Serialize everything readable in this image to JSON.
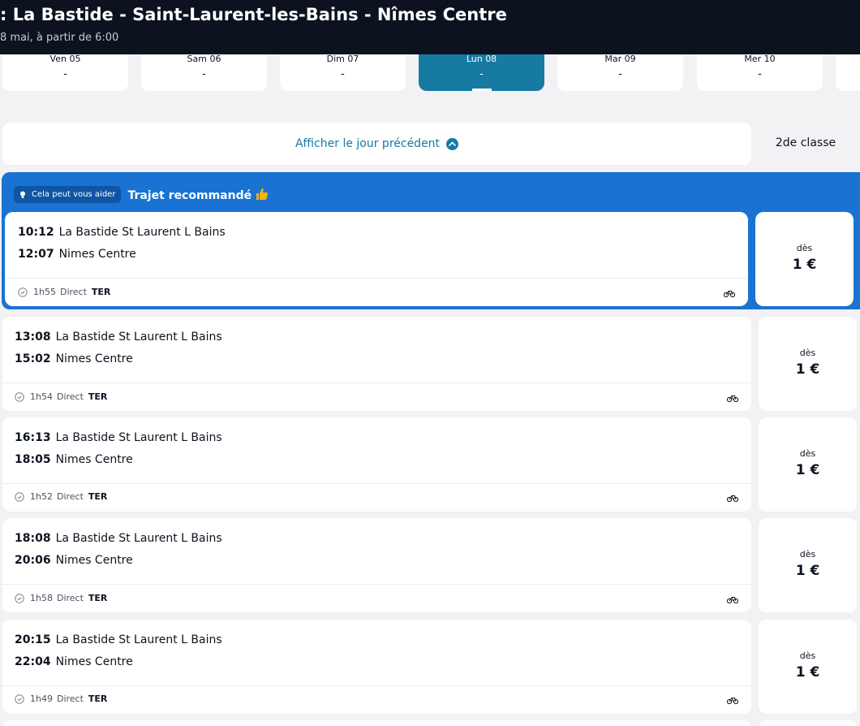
{
  "header": {
    "title": ": La Bastide - Saint-Laurent-les-Bains - Nîmes Centre",
    "subtitle": "8 mai, à partir de 6:00"
  },
  "days": [
    {
      "label": "Ven 05",
      "price": "-"
    },
    {
      "label": "Sam 06",
      "price": "-"
    },
    {
      "label": "Dim 07",
      "price": "-"
    },
    {
      "label": "Lun 08",
      "price": "-",
      "selected": true
    },
    {
      "label": "Mar 09",
      "price": "-"
    },
    {
      "label": "Mer 10",
      "price": "-"
    }
  ],
  "prev_day_label": "Afficher le jour précédent",
  "class_label": "2de classe",
  "recommendation": {
    "help_label": "Cela peut vous aider",
    "title": "Trajet recommandé"
  },
  "price_from_label": "dès",
  "trips": [
    {
      "dep_time": "10:12",
      "dep_station": "La Bastide St Laurent L Bains",
      "arr_time": "12:07",
      "arr_station": "Nimes Centre",
      "duration": "1h55",
      "type": "Direct",
      "train": "TER",
      "price": "1 €"
    },
    {
      "dep_time": "13:08",
      "dep_station": "La Bastide St Laurent L Bains",
      "arr_time": "15:02",
      "arr_station": "Nimes Centre",
      "duration": "1h54",
      "type": "Direct",
      "train": "TER",
      "price": "1 €"
    },
    {
      "dep_time": "16:13",
      "dep_station": "La Bastide St Laurent L Bains",
      "arr_time": "18:05",
      "arr_station": "Nimes Centre",
      "duration": "1h52",
      "type": "Direct",
      "train": "TER",
      "price": "1 €"
    },
    {
      "dep_time": "18:08",
      "dep_station": "La Bastide St Laurent L Bains",
      "arr_time": "20:06",
      "arr_station": "Nimes Centre",
      "duration": "1h58",
      "type": "Direct",
      "train": "TER",
      "price": "1 €"
    },
    {
      "dep_time": "20:15",
      "dep_station": "La Bastide St Laurent L Bains",
      "arr_time": "22:04",
      "arr_station": "Nimes Centre",
      "duration": "1h49",
      "type": "Direct",
      "train": "TER",
      "price": "1 €"
    }
  ],
  "colors": {
    "header_bg": "#0c131f",
    "accent_teal": "#167aa3",
    "recommended_blue": "#1a73d2",
    "page_bg": "#f2f2f4"
  },
  "icons": [
    "lightbulb-icon",
    "thumbs-up-icon",
    "chevron-up-icon",
    "clock-icon",
    "bicycle-icon"
  ]
}
